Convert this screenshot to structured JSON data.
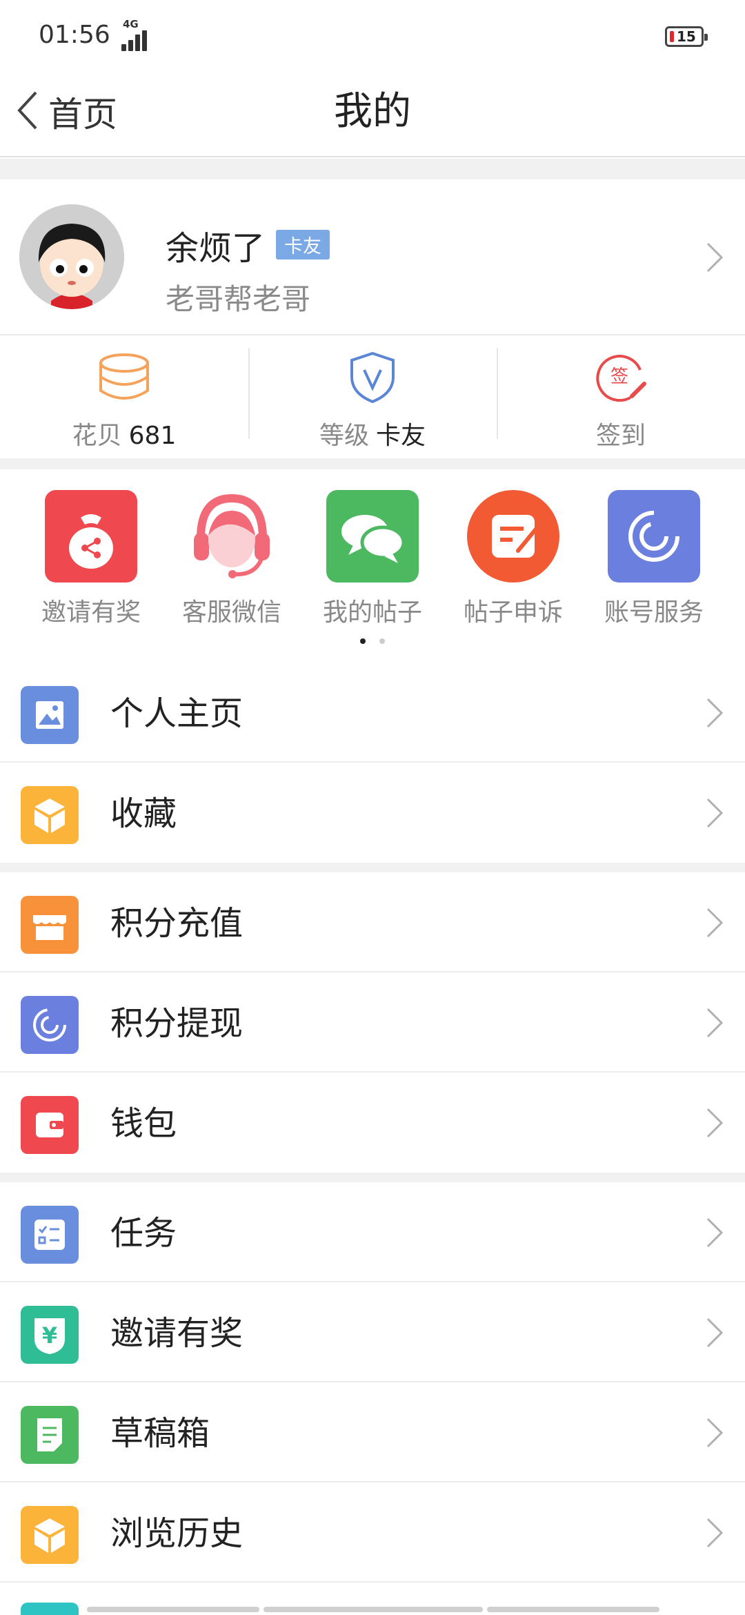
{
  "status_bar": {
    "time": "01:56",
    "network": "4G",
    "battery": "15"
  },
  "nav": {
    "back_label": "首页",
    "title": "我的"
  },
  "profile": {
    "username": "余烦了",
    "badge": "卡友",
    "signature": "老哥帮老哥"
  },
  "stats": [
    {
      "label": "花贝",
      "value": "681",
      "icon": "coins-icon",
      "color": "#f5a35b"
    },
    {
      "label": "等级",
      "value": "卡友",
      "icon": "shield-v-icon",
      "color": "#5b86d6"
    },
    {
      "label": "签到",
      "value": "",
      "icon": "sign-in-icon",
      "color": "#e84b4b"
    }
  ],
  "shortcuts": [
    {
      "label": "邀请有奖",
      "icon": "money-bag-icon",
      "color": "#f0484f"
    },
    {
      "label": "客服微信",
      "icon": "customer-service-icon",
      "color": "#f26a78"
    },
    {
      "label": "我的帖子",
      "icon": "chat-bubbles-icon",
      "color": "#4cb860"
    },
    {
      "label": "帖子申诉",
      "icon": "edit-note-icon",
      "color": "#f25a34"
    },
    {
      "label": "账号服务",
      "icon": "swirl-icon",
      "color": "#6a7fde"
    }
  ],
  "pager": {
    "pages": 2,
    "current": 1
  },
  "menu_groups": [
    [
      {
        "label": "个人主页",
        "icon": "picture-icon",
        "color": "#6a8ede"
      },
      {
        "label": "收藏",
        "icon": "box-icon",
        "color": "#fbb33a"
      }
    ],
    [
      {
        "label": "积分充值",
        "icon": "shop-icon",
        "color": "#f7923a"
      },
      {
        "label": "积分提现",
        "icon": "swirl-icon",
        "color": "#6a7fde"
      },
      {
        "label": "钱包",
        "icon": "wallet-icon",
        "color": "#f0484f"
      }
    ],
    [
      {
        "label": "任务",
        "icon": "task-list-icon",
        "color": "#6a8ede"
      },
      {
        "label": "邀请有奖",
        "icon": "yuan-shield-icon",
        "color": "#2fbd96"
      },
      {
        "label": "草稿箱",
        "icon": "draft-icon",
        "color": "#4cb860"
      },
      {
        "label": "浏览历史",
        "icon": "box-icon",
        "color": "#fbb33a"
      }
    ]
  ]
}
